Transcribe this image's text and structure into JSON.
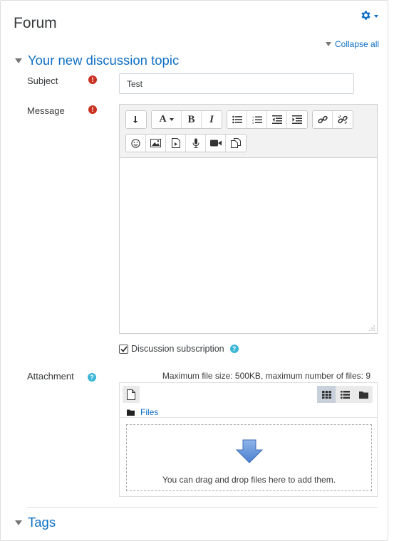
{
  "page": {
    "title": "Forum",
    "collapse_all": "Collapse all"
  },
  "section": {
    "title": "Your new discussion topic"
  },
  "subject": {
    "label": "Subject",
    "value": "Test"
  },
  "message": {
    "label": "Message"
  },
  "subscription": {
    "label": "Discussion subscription",
    "checked": true
  },
  "attachment": {
    "label": "Attachment",
    "max_info": "Maximum file size: 500KB, maximum number of files: 9",
    "folder": "Files",
    "drop_text": "You can drag and drop files here to add them."
  },
  "tags": {
    "title": "Tags"
  },
  "colors": {
    "link": "#0f6fc5",
    "required": "#ca3120",
    "help": "#3bb6d7"
  }
}
